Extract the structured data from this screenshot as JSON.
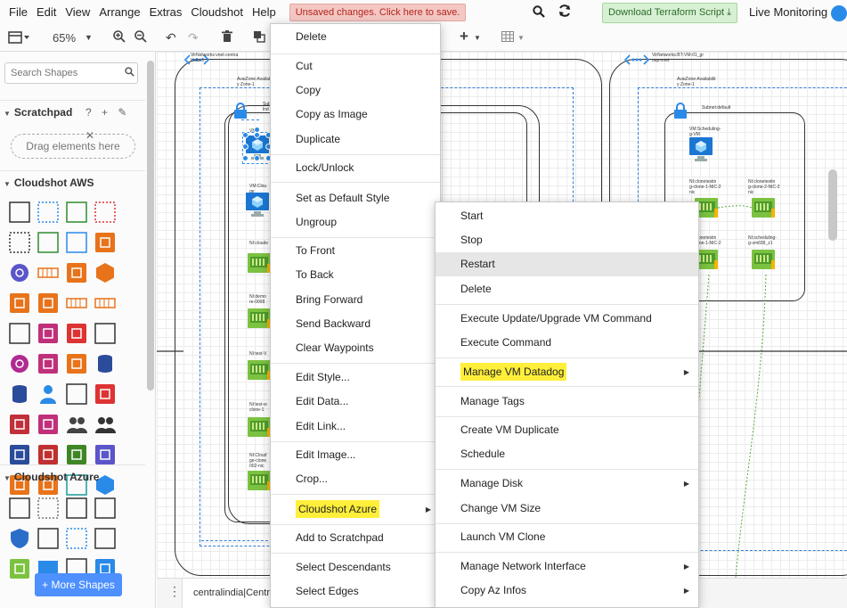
{
  "menubar": {
    "items": [
      "File",
      "Edit",
      "View",
      "Arrange",
      "Extras",
      "Cloudshot",
      "Help"
    ],
    "unsaved": "Unsaved changes. Click here to save.",
    "download": "Download Terraform Script",
    "live": "Live Monitoring"
  },
  "toolbar": {
    "zoom": "65%"
  },
  "sidebar": {
    "search_placeholder": "Search Shapes",
    "scratchpad": "Scratchpad",
    "scratch_tools": "? + ✎ ✕",
    "drag_here": "Drag elements here",
    "aws": "Cloudshot AWS",
    "azure": "Cloudshot Azure",
    "more_shapes": "+ More Shapes"
  },
  "canvas": {
    "left_vnet": "VirNetworks:vnet-centra\nIndia-1",
    "left_zone": "AvaiZone:Availab\ny Zone-1",
    "left_subnet": "Sub\nlnd",
    "left_vm1": "VM:",
    "left_vm2": "VM:Clou\nge",
    "left_nic1": "NI:cloude",
    "left_nic2": "NI:demo\nre-0008",
    "left_nic3": "NI:test-V",
    "left_nic4": "NI:test-w\nclone-1",
    "left_nic5": "NI:Cloud\nge-clone\n002-nic",
    "right_vnet": "VirNetworks:BT-VM-01_gr\noup-vnet",
    "right_zone": "AvaiZone:Availabilit\ny Zone-1",
    "right_subnet": "Subnet:default",
    "right_vm": "VM:Scheduling-\ng-VM",
    "right_nic1": "NI:clonetestin\ng-clone-1-NIC-2\nnic",
    "right_nic2": "NI:clonetestin\ng-clone-2-NIC-2\nnic",
    "right_nic3": "NI:clonetestin\ng-clone-1-NIC-2",
    "right_nic4": "NI:scheduling-\ng-vm699_z1"
  },
  "bottombar": {
    "tab": "centralindia|Centra"
  },
  "context_menu_main": [
    "Delete",
    "Cut",
    "Copy",
    "Copy as Image",
    "Duplicate",
    "Lock/Unlock",
    "Set as Default Style",
    "Ungroup",
    "To Front",
    "To Back",
    "Bring Forward",
    "Send Backward",
    "Clear Waypoints",
    "Edit Style...",
    "Edit Data...",
    "Edit Link...",
    "Edit Image...",
    "Crop...",
    "Cloudshot Azure",
    "Add to Scratchpad",
    "Select Descendants",
    "Select Edges"
  ],
  "context_menu_azure": [
    "Start",
    "Stop",
    "Restart",
    "Delete",
    "Execute Update/Upgrade VM Command",
    "Execute Command",
    "Manage VM Datadog",
    "Manage Tags",
    "Create VM Duplicate",
    "Schedule",
    "Manage Disk",
    "Change VM Size",
    "Launch VM Clone",
    "Manage Network Interface",
    "Copy Az Infos"
  ],
  "colors": {
    "highlight": "#ffef3a",
    "azure_blue": "#2a8ae8",
    "nic_green": "#7cc241"
  }
}
